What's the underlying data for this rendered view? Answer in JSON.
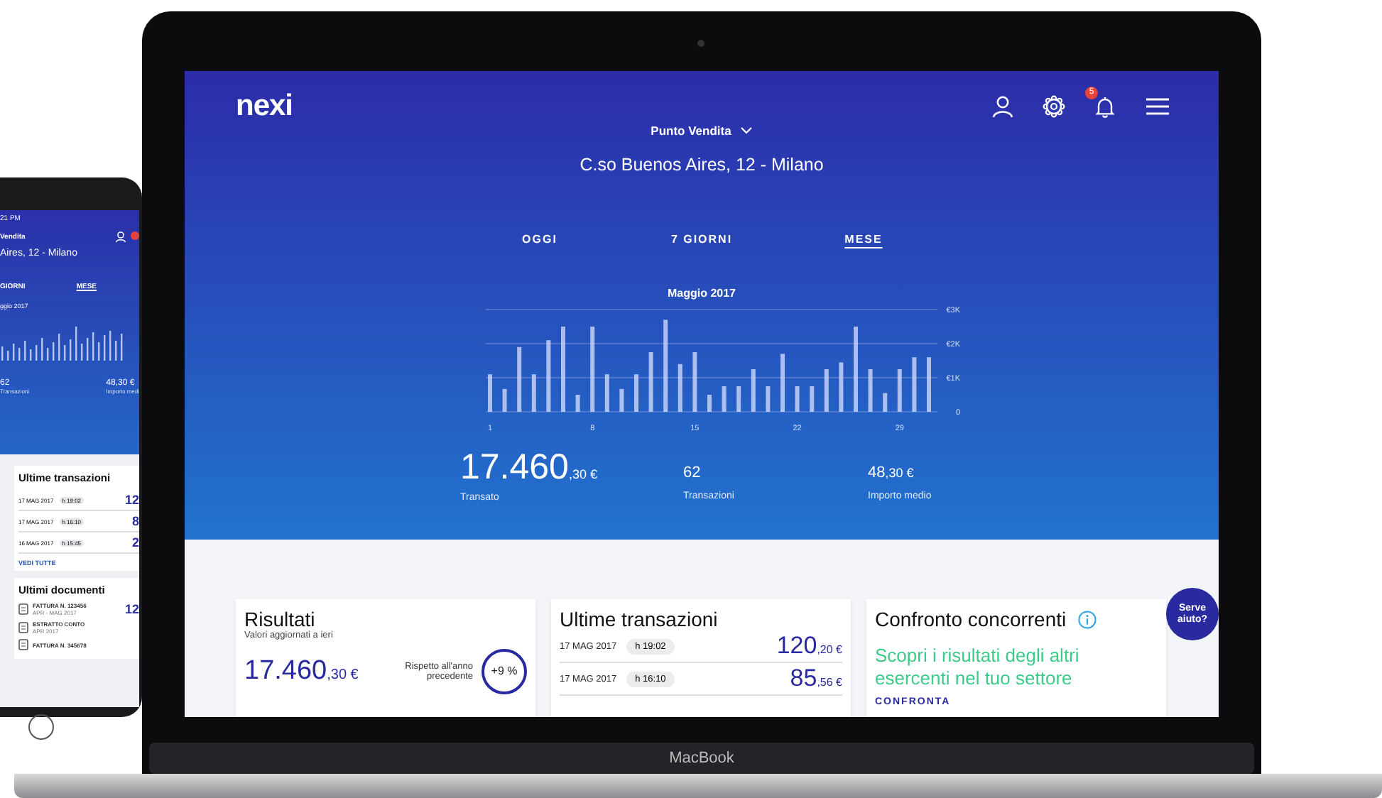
{
  "laptop": {
    "brand_label": "MacBook"
  },
  "header": {
    "logo": "nexi",
    "notifications_badge": "5",
    "store_label": "Punto Vendita",
    "address": "C.so Buenos Aires, 12 - Milano"
  },
  "period_tabs": [
    {
      "label": "OGGI",
      "selected": false
    },
    {
      "label": "7 GIORNI",
      "selected": false
    },
    {
      "label": "MESE",
      "selected": true
    }
  ],
  "chart": {
    "chart_data": {
      "type": "bar",
      "title": "Maggio 2017",
      "x": [
        1,
        2,
        3,
        4,
        5,
        6,
        7,
        8,
        9,
        10,
        11,
        12,
        13,
        14,
        15,
        16,
        17,
        18,
        19,
        20,
        21,
        22,
        23,
        24,
        25,
        26,
        27,
        28,
        29,
        30,
        31
      ],
      "xlim": [
        1,
        31
      ],
      "values": [
        1100,
        670,
        1900,
        1100,
        2100,
        2500,
        500,
        2500,
        1100,
        670,
        1100,
        1750,
        2700,
        1400,
        1750,
        500,
        750,
        750,
        1250,
        750,
        1700,
        750,
        750,
        1250,
        1450,
        2500,
        1250,
        550,
        1250,
        1600,
        1600
      ],
      "xticks": [
        1,
        8,
        15,
        22,
        29
      ],
      "ylim": [
        0,
        3000
      ],
      "yticks": [
        {
          "value": 0,
          "label": "0"
        },
        {
          "value": 1000,
          "label": "€1K"
        },
        {
          "value": 2000,
          "label": "€2K"
        },
        {
          "value": 3000,
          "label": "€3K"
        }
      ]
    }
  },
  "summary": [
    {
      "kind": "primary",
      "integer": "17.460",
      "decimal": ",30 €",
      "label": "Transato"
    },
    {
      "kind": "secondary",
      "integer": "62",
      "label": "Transazioni"
    },
    {
      "kind": "secondary",
      "integer": "48",
      "decimal": ",30 €",
      "label": "Importo medio"
    }
  ],
  "results_card": {
    "title": "Risultati",
    "subtitle": "Valori aggiornati a ieri",
    "integer": "17.460",
    "decimal": ",30 €",
    "comparison_label": "Rispetto all'anno precedente",
    "change": "+9 %"
  },
  "transactions_card": {
    "title": "Ultime transazioni",
    "rows": [
      {
        "date": "17 MAG 2017",
        "time": "h 19:02",
        "integer": "120",
        "decimal": ",20 €"
      },
      {
        "date": "17 MAG 2017",
        "time": "h 16:10",
        "integer": "85",
        "decimal": ",56 €"
      }
    ]
  },
  "compare_card": {
    "title": "Confronto concorrenti",
    "message": "Scopri i risultati degli altri esercenti nel tuo settore",
    "link": "CONFRONTA"
  },
  "help_button": "Serve aiuto?",
  "tablet": {
    "time": "21 PM",
    "store_label": "Vendita",
    "address": "Aires, 12 - Milano",
    "tabs": [
      {
        "label": "GIORNI",
        "selected": false
      },
      {
        "label": "MESE",
        "selected": true
      }
    ],
    "chart_title": "ggio 2017",
    "summary": [
      {
        "value": "62",
        "label": "Transazioni"
      },
      {
        "value": "48,30 €",
        "label": "Importo medi"
      }
    ],
    "transactions_title": "Ultime transazioni",
    "transactions": [
      {
        "date": "17 MAG 2017",
        "time": "h 19:02",
        "amount": "12"
      },
      {
        "date": "17 MAG 2017",
        "time": "h 16:10",
        "amount": "8"
      },
      {
        "date": "16 MAG 2017",
        "time": "h 15:45",
        "amount": "2"
      }
    ],
    "link": "VEDI TUTTE",
    "documents_title": "Ultimi documenti",
    "documents": [
      {
        "title": "FATTURA N. 123456",
        "subtitle": "APR - MAG 2017",
        "amount": "12"
      },
      {
        "title": "ESTRATTO CONTO",
        "subtitle": "APR 2017"
      },
      {
        "title": "FATTURA N. 345678"
      }
    ]
  }
}
